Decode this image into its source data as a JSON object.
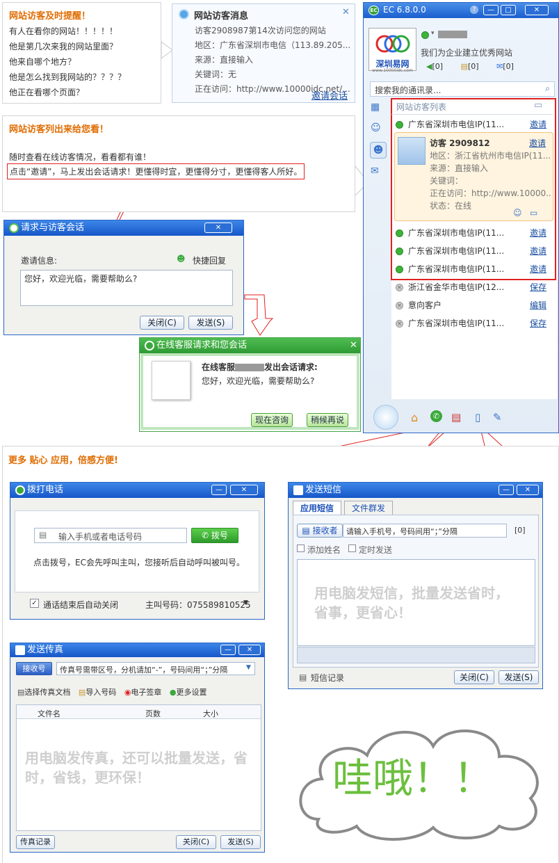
{
  "reminder": {
    "title": "网站访客及时提醒！",
    "lines": [
      "有人在看你的网站！！！！！",
      "他是第几次来我的网站里面？",
      "他来自哪个地方？",
      "他是怎么找到我网站的？？？？",
      "他正在看哪个页面？"
    ]
  },
  "visitor_msg": {
    "title": "网站访客消息",
    "line1": "访客2908987第14次访问您的网站",
    "region": "地区：广东省深圳市电信（113.89.205...",
    "source": "来源：直接输入",
    "keyword": "关键词：无",
    "visiting": "正在访问：http://www.10000idc.net/...",
    "invite": "邀请会话"
  },
  "list_promo": {
    "title": "网站访客列出来给您看！",
    "line1": "随时查看在线访客情况，看看都有谁！",
    "line2": "点击“邀请”，马上发出会话请求！更懂得时宜，更懂得分寸，更懂得客人所好。"
  },
  "ec": {
    "title": "EC 6.8.0.0",
    "logo_text": "深圳易网",
    "logo_url": "www.10000idc.com",
    "slogan": "我们为企业建立优秀网站",
    "counts": [
      "[0]",
      "[0]",
      "[0]"
    ],
    "search_placeholder": "搜索我的通讯录...",
    "list_header": "网站访客列表",
    "online_rows": [
      {
        "name": "广东省深圳市电信IP(11...",
        "action": "邀请"
      },
      {
        "name": "广东省深圳市电信IP(11...",
        "action": "邀请"
      },
      {
        "name": "广东省深圳市电信IP(11...",
        "action": "邀请"
      },
      {
        "name": "广东省深圳市电信IP(11...",
        "action": "邀请"
      }
    ],
    "card": {
      "visitor": "访客  2909812",
      "action": "邀请",
      "region": "地区：浙江省杭州市电信IP(11...",
      "source": "来源：直接输入",
      "keyword": "关键词：",
      "visiting": "正在访问：http://www.10000...",
      "status": "状态：在线"
    },
    "offline_rows": [
      {
        "name": "浙江省金华市电信IP(12...",
        "action": "保存"
      },
      {
        "name": "意向客户",
        "action": "编辑"
      },
      {
        "name": "广东省深圳市电信IP(11...",
        "action": "保存"
      }
    ]
  },
  "request_win": {
    "title": "请求与访客会话",
    "label": "邀请信息:",
    "quick": "快捷回复",
    "message": "您好，欢迎光临，需要帮助么?",
    "close": "关闭(C)",
    "send": "发送(S)"
  },
  "service_win": {
    "title": "在线客服请求和您会话",
    "line1a": "在线客服",
    "line1b": "发出会话请求:",
    "line2": "您好，欢迎光临，需要帮助么?",
    "consult": "现在咨询",
    "later": "稍候再说"
  },
  "more_title": "更多 贴心 应用，倍感方便!",
  "dial_win": {
    "title": "拨打电话",
    "placeholder": "输入手机或者电话号码",
    "dial": "拨号",
    "info": "点击拨号，EC会先呼叫主叫，您接听后自动呼叫被叫号。",
    "auto_close": "通话结束后自动关闭",
    "caller": "主叫号码：075589810525"
  },
  "sms_win": {
    "title": "发送短信",
    "tabs": [
      "应用短信",
      "文件群发"
    ],
    "receiver": "接收者",
    "phone_hint": "请输入手机号，号码间用“；”分隔",
    "count": "[0]",
    "add_name": "添加姓名",
    "timed": "定时发送",
    "promo": "用电脑发短信，批量发送省时，省事，更省心！",
    "record": "短信记录",
    "close": "关闭(C)",
    "send": "发送(S)"
  },
  "fax_win": {
    "title": "发送传真",
    "receiver": "接收号",
    "hint": "传真号需带区号，分机请加“-”，号码间用“；”分隔",
    "tools": [
      "选择传真文档",
      "导入号码",
      "电子签章",
      "更多设置"
    ],
    "cols": [
      "文件名",
      "页数",
      "大小"
    ],
    "promo": "用电脑发传真，还可以批量发送，省时，省钱，更环保！",
    "record": "传真记录",
    "close": "关闭(C)",
    "send": "发送(S)"
  },
  "wow": "哇哦！！"
}
